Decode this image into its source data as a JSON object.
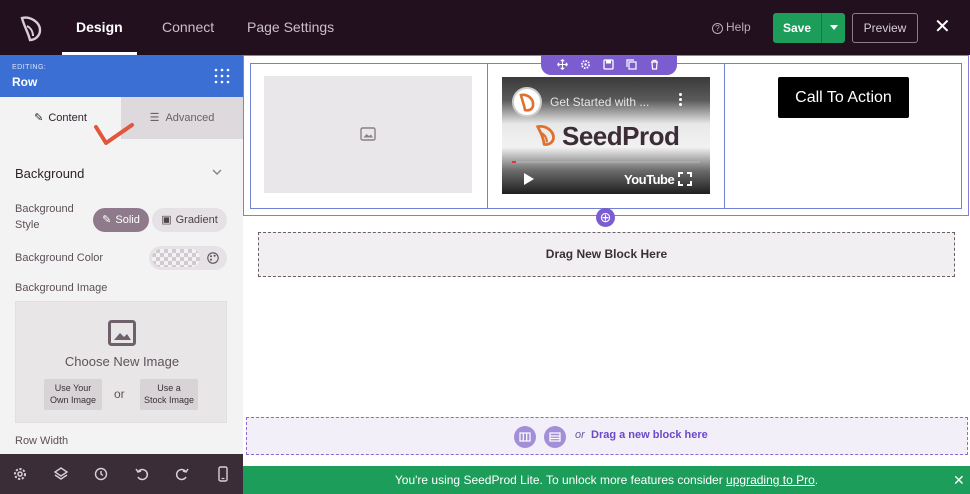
{
  "topbar": {
    "tabs": [
      {
        "label": "Design",
        "active": true
      },
      {
        "label": "Connect",
        "active": false
      },
      {
        "label": "Page Settings",
        "active": false
      }
    ],
    "help_label": "Help",
    "save_label": "Save",
    "preview_label": "Preview"
  },
  "sidebar": {
    "editing_small": "EDITING:",
    "editing_title": "Row",
    "tabs": [
      {
        "label": "Content",
        "active": true
      },
      {
        "label": "Advanced",
        "active": false
      }
    ],
    "section_title": "Background",
    "background_style_label_1": "Background",
    "background_style_label_2": "Style",
    "style_options": [
      "Solid",
      "Gradient"
    ],
    "background_color_label": "Background Color",
    "background_image_label": "Background Image",
    "choose_image_label": "Choose New Image",
    "own_image_label": [
      "Use Your",
      "Own Image"
    ],
    "stock_image_label": [
      "Use a",
      "Stock Image"
    ],
    "or_label": "or",
    "row_width_label": "Row Width"
  },
  "canvas": {
    "video_title": "Get Started with ...",
    "video_brand": "SeedProd",
    "video_platform": "YouTube",
    "cta_label": "Call To Action",
    "drag_label": "Drag New Block Here",
    "drop_or": "or",
    "drop_link": "Drag a new block here"
  },
  "banner": {
    "text": "You're using SeedProd Lite. To unlock more features consider ",
    "link": "upgrading to Pro",
    "suffix": "."
  },
  "colors": {
    "topbar": "#23101f",
    "accent_blue": "#3c6fd4",
    "accent_purple": "#7b5dd0",
    "green": "#1d9d5a"
  },
  "icons": [
    "seedprod-logo-icon",
    "help-icon",
    "close-icon",
    "grid-icon",
    "pencil-icon",
    "sliders-icon",
    "chevron-down-icon",
    "brush-icon",
    "gradient-icon",
    "palette-icon",
    "image-icon",
    "gear-icon",
    "layers-icon",
    "history-icon",
    "undo-icon",
    "redo-icon",
    "mobile-icon",
    "move-icon",
    "settings-icon",
    "save-icon",
    "duplicate-icon",
    "trash-icon",
    "plus-icon",
    "columns-icon",
    "section-icon"
  ]
}
